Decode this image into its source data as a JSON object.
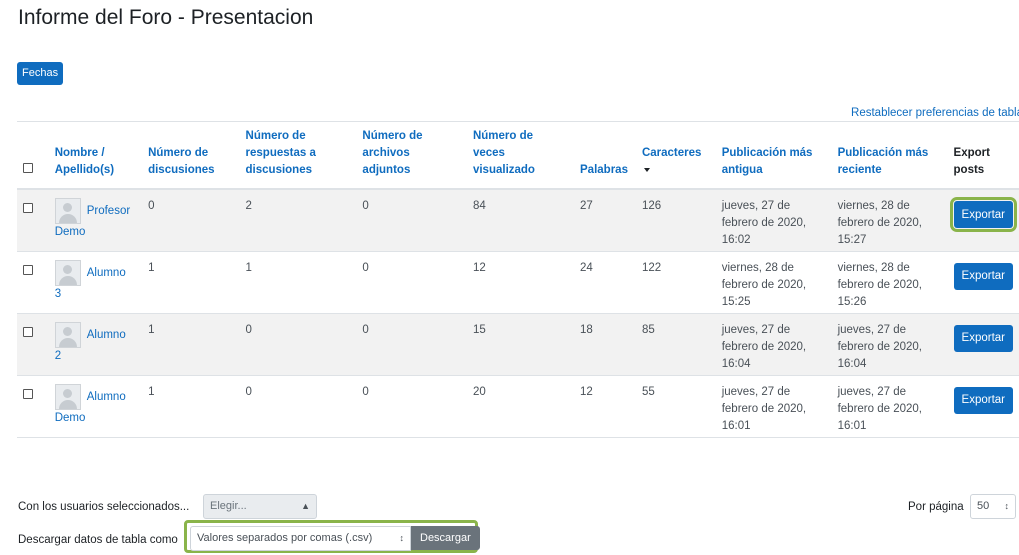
{
  "page": {
    "title": "Informe del Foro - Presentacion",
    "dates_button": "Fechas",
    "reset_link": "Restablecer preferencias de tabla"
  },
  "table": {
    "headers": {
      "name_first": "Nombre /",
      "name_last": "Apellido(s)",
      "discussions": [
        "Número de",
        "discusiones"
      ],
      "replies": [
        "Número de",
        "respuestas a",
        "discusiones"
      ],
      "attachments": [
        "Número de",
        "archivos",
        "adjuntos"
      ],
      "views": [
        "Número de",
        "veces",
        "visualizado"
      ],
      "words": "Palabras",
      "chars": "Caracteres",
      "earliest": [
        "Publicación más",
        "antigua"
      ],
      "latest": [
        "Publicación más",
        "reciente"
      ],
      "export": [
        "Export",
        "posts"
      ]
    },
    "export_label": "Exportar",
    "rows": [
      {
        "first": "Profesor",
        "last": "Demo",
        "discussions": "0",
        "replies": "2",
        "attachments": "0",
        "views": "84",
        "words": "27",
        "chars": "126",
        "earliest": [
          "jueves, 27 de",
          "febrero de 2020,",
          "16:02"
        ],
        "latest": [
          "viernes, 28 de",
          "febrero de 2020,",
          "15:27"
        ]
      },
      {
        "first": "Alumno",
        "last": "3",
        "discussions": "1",
        "replies": "1",
        "attachments": "0",
        "views": "12",
        "words": "24",
        "chars": "122",
        "earliest": [
          "viernes, 28 de",
          "febrero de 2020,",
          "15:25"
        ],
        "latest": [
          "viernes, 28 de",
          "febrero de 2020,",
          "15:26"
        ]
      },
      {
        "first": "Alumno",
        "last": "2",
        "discussions": "1",
        "replies": "0",
        "attachments": "0",
        "views": "15",
        "words": "18",
        "chars": "85",
        "earliest": [
          "jueves, 27 de",
          "febrero de 2020,",
          "16:04"
        ],
        "latest": [
          "jueves, 27 de",
          "febrero de 2020,",
          "16:04"
        ]
      },
      {
        "first": "Alumno",
        "last": "Demo",
        "discussions": "1",
        "replies": "0",
        "attachments": "0",
        "views": "20",
        "words": "12",
        "chars": "55",
        "earliest": [
          "jueves, 27 de",
          "febrero de 2020,",
          "16:01"
        ],
        "latest": [
          "jueves, 27 de",
          "febrero de 2020,",
          "16:01"
        ]
      }
    ]
  },
  "bulk": {
    "label": "Con los usuarios seleccionados...",
    "select_value": "Elegir..."
  },
  "per_page": {
    "label": "Por página",
    "value": "50"
  },
  "download": {
    "label": "Descargar datos de tabla como",
    "format_value": "Valores separados por comas (.csv)",
    "button": "Descargar"
  },
  "icons": {
    "sort": "sort-desc-icon",
    "select_arrows": "updown-icon",
    "avatar": "default-user-icon"
  },
  "colors": {
    "primary": "#0f6cbf",
    "highlight": "#8ab44a",
    "secondary": "#6a737b"
  }
}
